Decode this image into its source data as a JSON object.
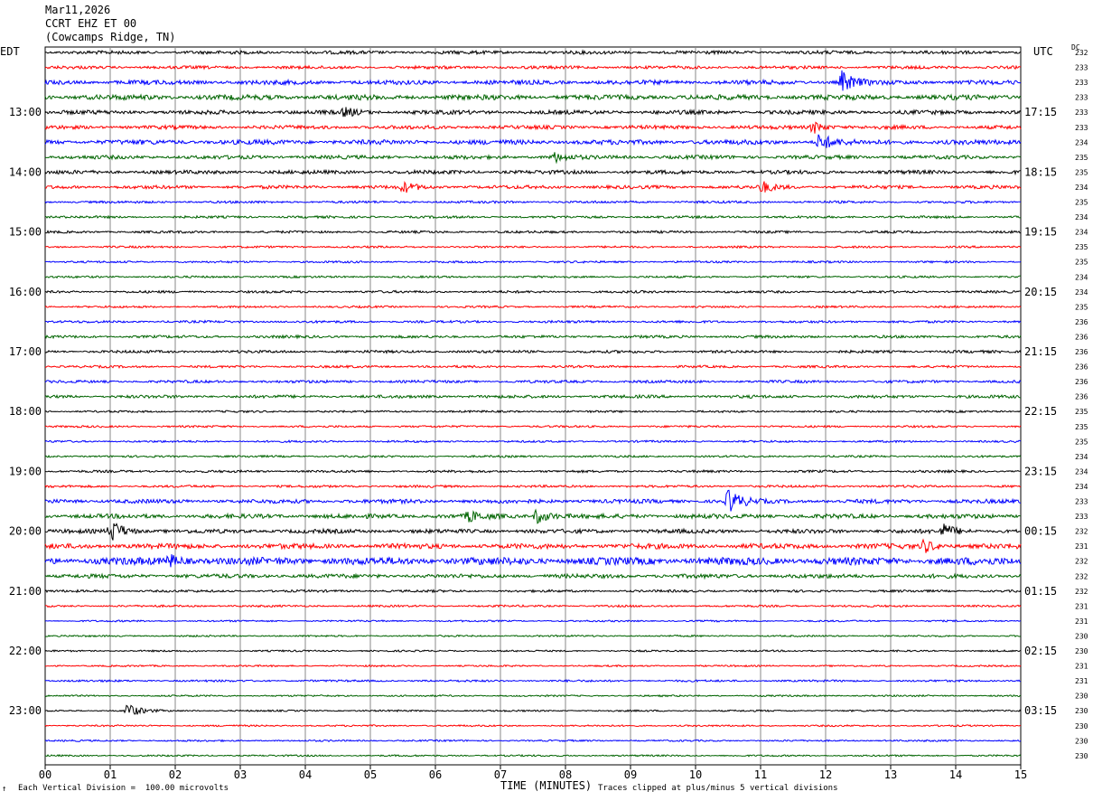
{
  "header": {
    "date": "Mar11,2026",
    "station": "CCRT EHZ ET 00",
    "location": "(Cowcamps Ridge, TN)"
  },
  "left_tz": "EDT",
  "right_tz": "UTC",
  "dc_label": "DC",
  "footer": {
    "left_mark": "↑",
    "scale_note": "Each Vertical Division =  100.00 microvolts",
    "xlabel": "TIME (MINUTES)",
    "clip_note": "Traces clipped at plus/minus 5 vertical divisions"
  },
  "chart_data": {
    "type": "line",
    "title": "",
    "xlabel": "TIME (MINUTES)",
    "xlim": [
      0,
      15
    ],
    "x_ticks": [
      "00",
      "01",
      "02",
      "03",
      "04",
      "05",
      "06",
      "07",
      "08",
      "09",
      "10",
      "11",
      "12",
      "13",
      "14",
      "15"
    ],
    "grid": true,
    "rows_count": 48,
    "minutes_per_row": 15,
    "trace_colors": [
      "#000000",
      "#ff0000",
      "#0000ff",
      "#006400"
    ],
    "left_hour_labels": [
      {
        "row": 4,
        "label": "13:00"
      },
      {
        "row": 8,
        "label": "14:00"
      },
      {
        "row": 12,
        "label": "15:00"
      },
      {
        "row": 16,
        "label": "16:00"
      },
      {
        "row": 20,
        "label": "17:00"
      },
      {
        "row": 24,
        "label": "18:00"
      },
      {
        "row": 28,
        "label": "19:00"
      },
      {
        "row": 32,
        "label": "20:00"
      },
      {
        "row": 36,
        "label": "21:00"
      },
      {
        "row": 40,
        "label": "22:00"
      },
      {
        "row": 44,
        "label": "23:00"
      }
    ],
    "right_hour_labels": [
      {
        "row": 4,
        "label": "17:15"
      },
      {
        "row": 8,
        "label": "18:15"
      },
      {
        "row": 12,
        "label": "19:15"
      },
      {
        "row": 16,
        "label": "20:15"
      },
      {
        "row": 20,
        "label": "21:15"
      },
      {
        "row": 24,
        "label": "22:15"
      },
      {
        "row": 28,
        "label": "23:15"
      },
      {
        "row": 32,
        "label": "00:15"
      },
      {
        "row": 36,
        "label": "01:15"
      },
      {
        "row": 40,
        "label": "02:15"
      },
      {
        "row": 44,
        "label": "03:15"
      }
    ],
    "dc_values": [
      "232",
      "233",
      "233",
      "233",
      "233",
      "233",
      "234",
      "235",
      "235",
      "234",
      "235",
      "234",
      "234",
      "235",
      "235",
      "234",
      "234",
      "235",
      "236",
      "236",
      "236",
      "236",
      "236",
      "236",
      "235",
      "235",
      "235",
      "234",
      "234",
      "234",
      "233",
      "233",
      "232",
      "231",
      "232",
      "232",
      "232",
      "231",
      "231",
      "230",
      "230",
      "231",
      "231",
      "230",
      "230",
      "230",
      "230",
      "230"
    ],
    "row_activity": [
      1.0,
      0.9,
      1.3,
      1.5,
      1.2,
      1.1,
      1.4,
      1.1,
      1.1,
      1.0,
      0.7,
      0.7,
      0.7,
      0.6,
      0.6,
      0.6,
      0.7,
      0.6,
      0.7,
      0.8,
      0.8,
      0.7,
      0.8,
      0.9,
      0.6,
      0.6,
      0.6,
      0.6,
      0.7,
      0.7,
      1.2,
      1.3,
      1.2,
      1.5,
      2.2,
      1.2,
      0.7,
      0.6,
      0.5,
      0.5,
      0.5,
      0.5,
      0.6,
      0.5,
      0.5,
      0.5,
      0.5,
      0.5
    ],
    "events": [
      {
        "row": 2,
        "minute": 12.25,
        "amp": 12
      },
      {
        "row": 4,
        "minute": 4.6,
        "amp": 5
      },
      {
        "row": 5,
        "minute": 11.8,
        "amp": 7
      },
      {
        "row": 6,
        "minute": 11.9,
        "amp": 10
      },
      {
        "row": 7,
        "minute": 7.8,
        "amp": 6
      },
      {
        "row": 9,
        "minute": 5.5,
        "amp": 6
      },
      {
        "row": 9,
        "minute": 11.0,
        "amp": 7
      },
      {
        "row": 30,
        "minute": 10.5,
        "amp": 14
      },
      {
        "row": 31,
        "minute": 7.55,
        "amp": 9
      },
      {
        "row": 31,
        "minute": 6.5,
        "amp": 6
      },
      {
        "row": 32,
        "minute": 1.0,
        "amp": 14
      },
      {
        "row": 32,
        "minute": 13.8,
        "amp": 8
      },
      {
        "row": 33,
        "minute": 13.5,
        "amp": 7
      },
      {
        "row": 34,
        "minute": 1.9,
        "amp": 6
      },
      {
        "row": 44,
        "minute": 1.25,
        "amp": 9
      }
    ]
  }
}
